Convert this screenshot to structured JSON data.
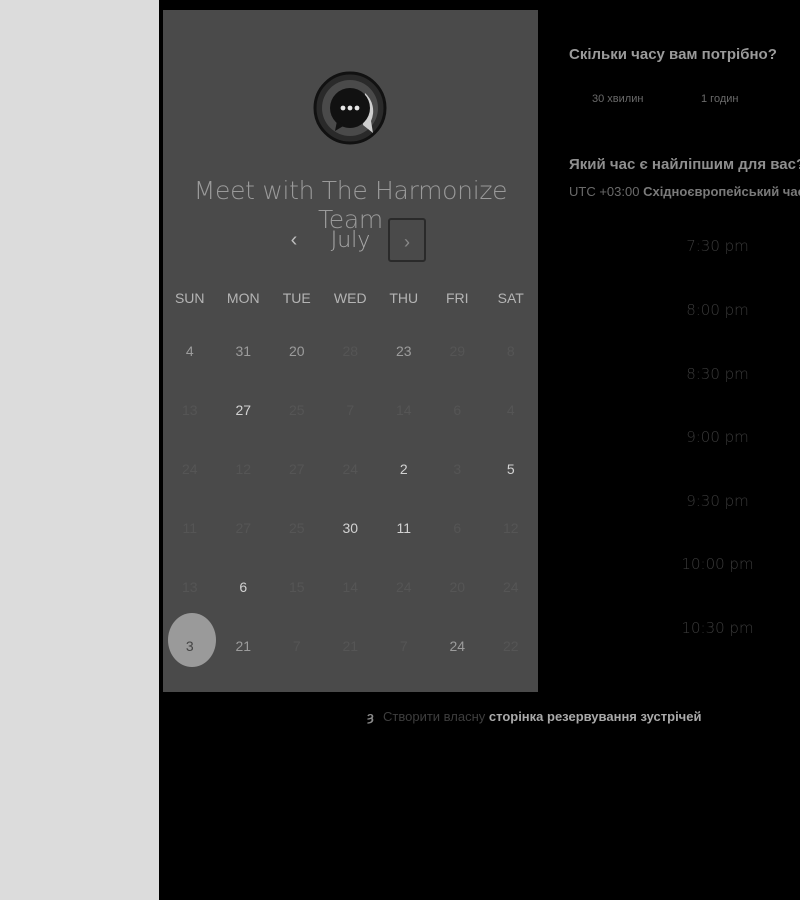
{
  "card": {
    "title": "Meet with The Harmonize Team",
    "month": "July",
    "prev_label": "‹",
    "next_label": "›",
    "weekdays": [
      "SUN",
      "MON",
      "TUE",
      "WED",
      "THU",
      "FRI",
      "SAT"
    ],
    "weeks": [
      [
        {
          "d": "4",
          "s": "mid"
        },
        {
          "d": "31",
          "s": "mid"
        },
        {
          "d": "20",
          "s": "mid"
        },
        {
          "d": "28",
          "s": "dim"
        },
        {
          "d": "23",
          "s": "mid"
        },
        {
          "d": "29",
          "s": "dim"
        },
        {
          "d": "8",
          "s": "dim"
        }
      ],
      [
        {
          "d": "13",
          "s": "dim"
        },
        {
          "d": "27",
          "s": "bright"
        },
        {
          "d": "25",
          "s": "dim"
        },
        {
          "d": "7",
          "s": "dim"
        },
        {
          "d": "14",
          "s": "dim"
        },
        {
          "d": "6",
          "s": "dim"
        },
        {
          "d": "4",
          "s": "dim"
        }
      ],
      [
        {
          "d": "24",
          "s": "dim"
        },
        {
          "d": "12",
          "s": "dim"
        },
        {
          "d": "27",
          "s": "dim"
        },
        {
          "d": "24",
          "s": "dim"
        },
        {
          "d": "2",
          "s": "bright"
        },
        {
          "d": "3",
          "s": "dim"
        },
        {
          "d": "5",
          "s": "bright"
        }
      ],
      [
        {
          "d": "11",
          "s": "dim"
        },
        {
          "d": "27",
          "s": "dim"
        },
        {
          "d": "25",
          "s": "dim"
        },
        {
          "d": "30",
          "s": "bright"
        },
        {
          "d": "11",
          "s": "bright"
        },
        {
          "d": "6",
          "s": "dim"
        },
        {
          "d": "12",
          "s": "dim"
        }
      ],
      [
        {
          "d": "13",
          "s": "dim"
        },
        {
          "d": "6",
          "s": "bright"
        },
        {
          "d": "15",
          "s": "dim"
        },
        {
          "d": "14",
          "s": "dim"
        },
        {
          "d": "24",
          "s": "dim"
        },
        {
          "d": "20",
          "s": "dim"
        },
        {
          "d": "24",
          "s": "dim"
        }
      ],
      [
        {
          "d": "3",
          "s": "sel"
        },
        {
          "d": "21",
          "s": "mid"
        },
        {
          "d": "7",
          "s": "dim"
        },
        {
          "d": "21",
          "s": "dim"
        },
        {
          "d": "7",
          "s": "dim"
        },
        {
          "d": "24",
          "s": "mid"
        },
        {
          "d": "22",
          "s": "dim"
        }
      ]
    ]
  },
  "duration": {
    "heading": "Скільки часу вам потрібно?",
    "options": [
      "30 хвилин",
      "1 годин"
    ]
  },
  "time": {
    "heading": "Який час є найліпшим для вас?",
    "tz_offset": "UTC +03:00",
    "tz_name": "Східноєвропейський час",
    "slots": [
      "7:30 pm",
      "8:00 pm",
      "8:30 pm",
      "9:00 pm",
      "9:30 pm",
      "10:00 pm",
      "10:30 pm"
    ]
  },
  "footer": {
    "icon": "hubspot-sprocket-icon",
    "prefix": "Створити власну",
    "link": "сторінка резервування зустрічей"
  },
  "colors": {
    "left_strip": "#dcdcdc",
    "card_bg": "#4a4a4a",
    "page_bg": "#000000"
  }
}
